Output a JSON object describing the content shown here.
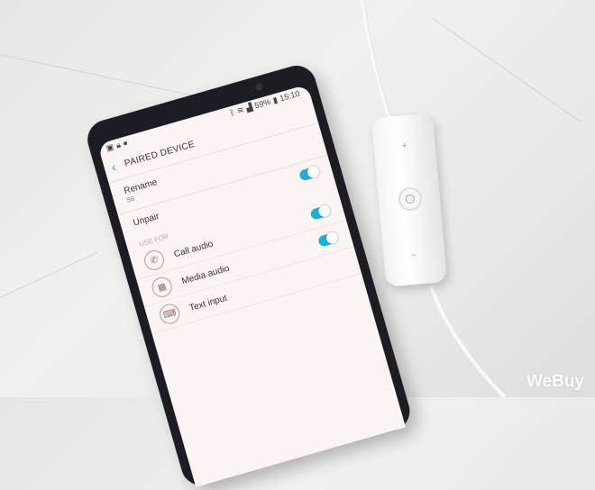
{
  "status_bar": {
    "battery": "59%",
    "time": "15:10"
  },
  "header": {
    "back_icon": "chevron-left-icon",
    "title": "PAIRED DEVICE"
  },
  "rename": {
    "label": "Rename",
    "value": "S6"
  },
  "unpair": {
    "label": "Unpair",
    "toggle_on": true
  },
  "use_for": {
    "section_label": "USE FOR",
    "items": [
      {
        "label": "Call audio",
        "icon": "phone-icon",
        "toggle_on": true
      },
      {
        "label": "Media audio",
        "icon": "apps-icon",
        "toggle_on": true
      },
      {
        "label": "Text input",
        "icon": "keyboard-icon"
      }
    ]
  },
  "accent_color": "#1ab0d8",
  "watermark": "WeBuy"
}
